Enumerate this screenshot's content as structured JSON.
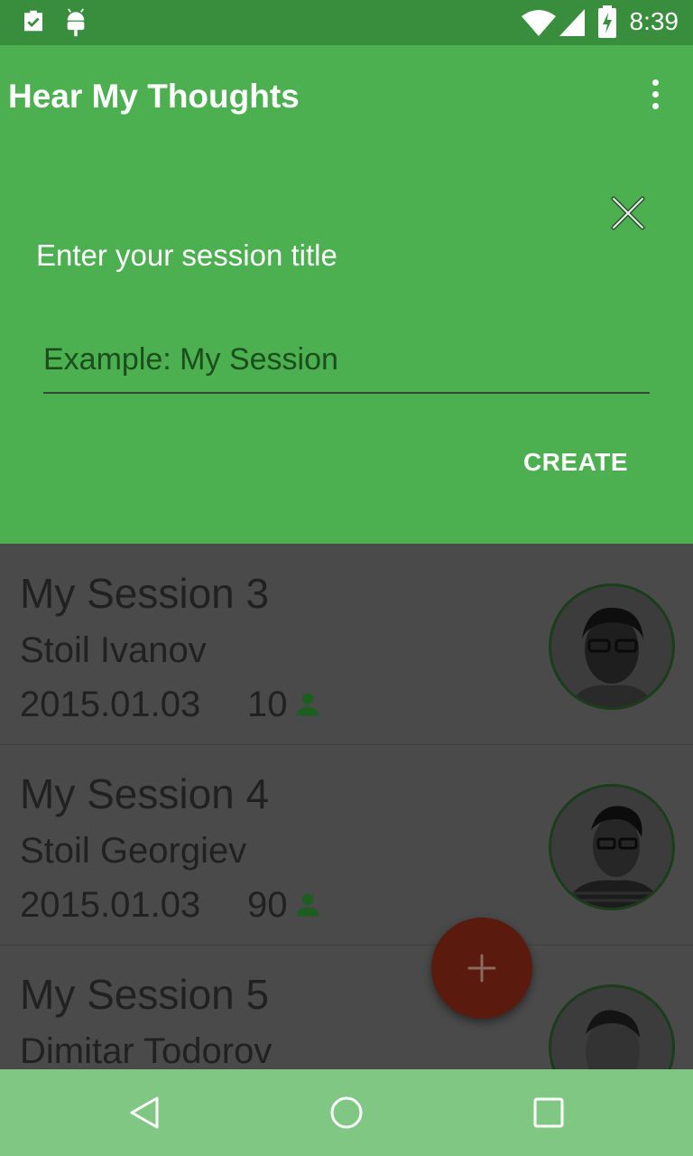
{
  "status_bar": {
    "time": "8:39",
    "icons": [
      "clipboard-check-icon",
      "android-icon",
      "wifi-icon",
      "cell-signal-icon",
      "battery-charging-icon"
    ]
  },
  "app_bar": {
    "title": "Hear My Thoughts",
    "menu_icon": "overflow-menu-icon"
  },
  "dialog": {
    "close_icon": "close-icon",
    "prompt": "Enter your session title",
    "input_placeholder": "Example: My Session",
    "input_value": "",
    "create_label": "CREATE"
  },
  "sessions": [
    {
      "title": "My Session 3",
      "author": "Stoil Ivanov",
      "date": "2015.01.03",
      "count": "10"
    },
    {
      "title": "My Session 4",
      "author": "Stoil Georgiev",
      "date": "2015.01.03",
      "count": "90"
    },
    {
      "title": "My Session 5",
      "author": "Dimitar Todorov",
      "date": "",
      "count": ""
    }
  ],
  "fab": {
    "icon": "add-icon"
  },
  "nav_bar": {
    "icons": [
      "back-icon",
      "home-icon",
      "recents-icon"
    ]
  },
  "colors": {
    "status_bar": "#388e3c",
    "primary": "#4caf50",
    "list_dim": "#4a4a4a",
    "fab_dim": "#5a1a0d",
    "nav_bar": "#81c784"
  }
}
